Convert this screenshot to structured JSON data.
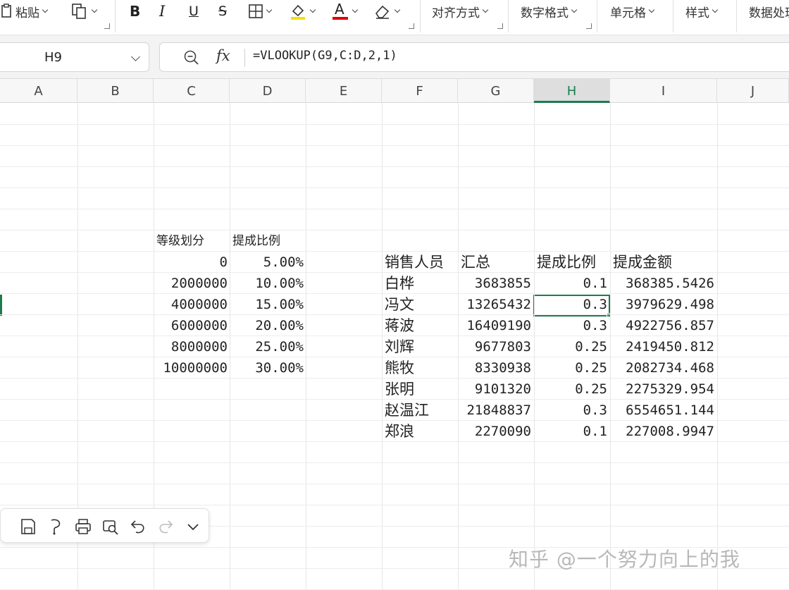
{
  "ribbon": {
    "paste_label": "粘贴",
    "align_label": "对齐方式",
    "number_label": "数字格式",
    "cell_label": "单元格",
    "style_label": "样式",
    "data_label": "数据处理",
    "bold_glyph": "B",
    "italic_glyph": "I",
    "underline_glyph": "U",
    "strike_glyph": "S",
    "font_color_glyph": "A",
    "fill_color": "#f2e100",
    "font_color": "#e00000"
  },
  "formula_bar": {
    "name_box": "H9",
    "fx_label": "fx",
    "formula": "=VLOOKUP(G9,C:D,2,1)"
  },
  "columns": [
    "A",
    "B",
    "C",
    "D",
    "E",
    "F",
    "G",
    "H",
    "I",
    "J"
  ],
  "active_column": "H",
  "tier_table": {
    "headers": [
      "等级划分",
      "提成比例"
    ],
    "rows": [
      [
        "0",
        "5.00%"
      ],
      [
        "2000000",
        "10.00%"
      ],
      [
        "4000000",
        "15.00%"
      ],
      [
        "6000000",
        "20.00%"
      ],
      [
        "8000000",
        "25.00%"
      ],
      [
        "10000000",
        "30.00%"
      ]
    ]
  },
  "sales_table": {
    "headers": [
      "销售人员",
      "汇总",
      "提成比例",
      "提成金额"
    ],
    "rows": [
      [
        "白桦",
        "3683855",
        "0.1",
        "368385.5426"
      ],
      [
        "冯文",
        "13265432",
        "0.3",
        "3979629.498"
      ],
      [
        "蒋波",
        "16409190",
        "0.3",
        "4922756.857"
      ],
      [
        "刘辉",
        "9677803",
        "0.25",
        "2419450.812"
      ],
      [
        "熊牧",
        "8330938",
        "0.25",
        "2082734.468"
      ],
      [
        "张明",
        "9101320",
        "0.25",
        "2275329.954"
      ],
      [
        "赵温江",
        "21848837",
        "0.3",
        "6554651.144"
      ],
      [
        "郑浪",
        "2270090",
        "0.1",
        "227008.9947"
      ]
    ]
  },
  "quick_toolbar": {
    "icons": [
      "save-icon",
      "format-painter-icon",
      "print-icon",
      "print-preview-icon",
      "undo-icon",
      "redo-icon",
      "more-chevron-icon"
    ]
  },
  "watermark": "知乎 @一个努力向上的我",
  "accent_color": "#1e7b4f"
}
